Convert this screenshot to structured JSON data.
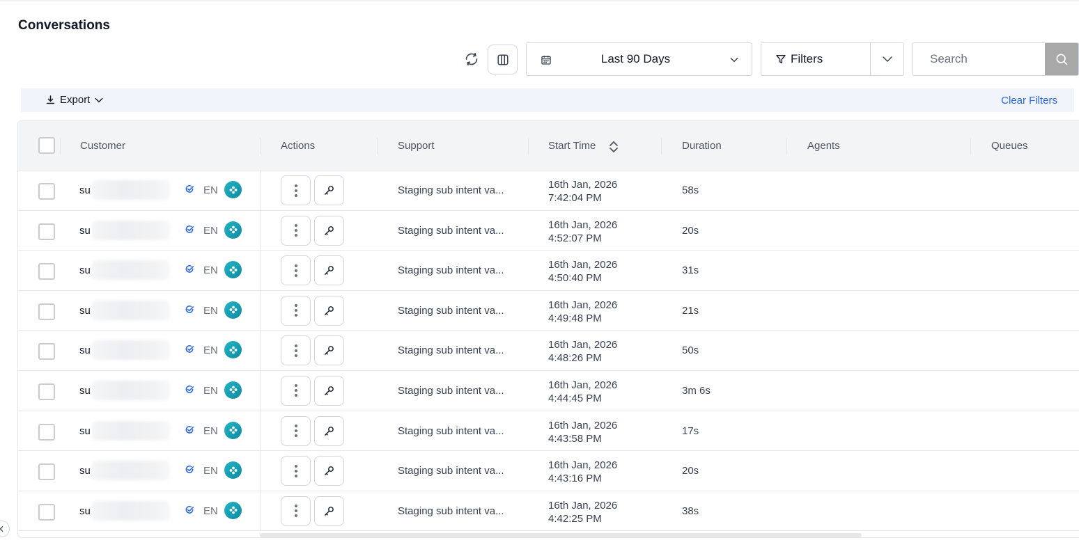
{
  "page": {
    "title": "Conversations"
  },
  "toolbar": {
    "refresh_icon": "refresh-icon",
    "columns_icon": "columns-icon",
    "date_range": "Last 90 Days",
    "filters_label": "Filters",
    "search_placeholder": "Search",
    "search_value": ""
  },
  "actions_bar": {
    "export_label": "Export",
    "clear_filters_label": "Clear Filters"
  },
  "table": {
    "columns": [
      "Customer",
      "Actions",
      "Support",
      "Start Time",
      "Duration",
      "Agents",
      "Queues"
    ],
    "rows": [
      {
        "customer": "su",
        "lang": "EN",
        "support": "Staging sub intent va...",
        "date": "16th Jan, 2026",
        "time": "7:42:04 PM",
        "duration": "58s"
      },
      {
        "customer": "su",
        "lang": "EN",
        "support": "Staging sub intent va...",
        "date": "16th Jan, 2026",
        "time": "4:52:07 PM",
        "duration": "20s"
      },
      {
        "customer": "su",
        "lang": "EN",
        "support": "Staging sub intent va...",
        "date": "16th Jan, 2026",
        "time": "4:50:40 PM",
        "duration": "31s"
      },
      {
        "customer": "su",
        "lang": "EN",
        "support": "Staging sub intent va...",
        "date": "16th Jan, 2026",
        "time": "4:49:48 PM",
        "duration": "21s"
      },
      {
        "customer": "su",
        "lang": "EN",
        "support": "Staging sub intent va...",
        "date": "16th Jan, 2026",
        "time": "4:48:26 PM",
        "duration": "50s"
      },
      {
        "customer": "su",
        "lang": "EN",
        "support": "Staging sub intent va...",
        "date": "16th Jan, 2026",
        "time": "4:44:45 PM",
        "duration": "3m 6s"
      },
      {
        "customer": "su",
        "lang": "EN",
        "support": "Staging sub intent va...",
        "date": "16th Jan, 2026",
        "time": "4:43:58 PM",
        "duration": "17s"
      },
      {
        "customer": "su",
        "lang": "EN",
        "support": "Staging sub intent va...",
        "date": "16th Jan, 2026",
        "time": "4:43:16 PM",
        "duration": "20s"
      },
      {
        "customer": "su",
        "lang": "EN",
        "support": "Staging sub intent va...",
        "date": "16th Jan, 2026",
        "time": "4:42:25 PM",
        "duration": "38s"
      }
    ]
  },
  "colors": {
    "accent_link": "#2563eb",
    "bot_badge": "#17a2b8",
    "verify_icon": "#2563eb",
    "search_button": "#a8a8a8"
  }
}
